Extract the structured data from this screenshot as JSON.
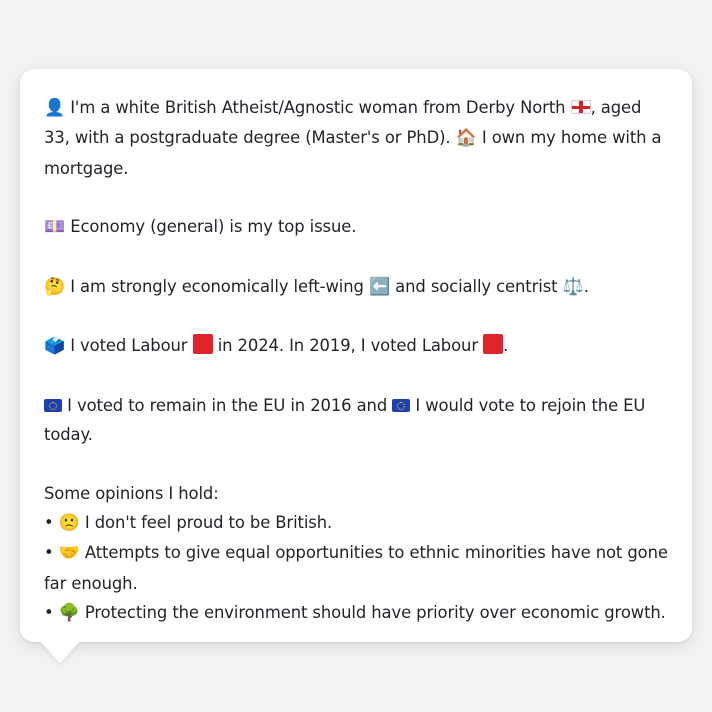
{
  "profile": {
    "p1": {
      "icon_person": "👤",
      "text_a": "I'm a white British Atheist/Agnostic woman from Derby North",
      "flag_england": "england-flag",
      "text_b": ", aged 33, with a postgraduate degree (Master's or PhD).",
      "icon_house": "🏠",
      "text_c": "I own my home with a mortgage."
    },
    "p2": {
      "icon_issue": "💷",
      "text": "Economy (general) is my top issue."
    },
    "p3": {
      "icon_think": "🤔",
      "text_a": "I am strongly economically left-wing",
      "icon_left": "⬅️",
      "text_b": "and socially centrist",
      "icon_scales": "⚖️",
      "text_c": "."
    },
    "p4": {
      "icon_ballot": "🗳️",
      "text_a": "I voted Labour",
      "party_color": "#e0252c",
      "text_b": "in 2024. In 2019, I voted Labour",
      "text_c": "."
    },
    "p5": {
      "flag_eu": "eu-flag",
      "text_a": "I voted to remain in the EU in 2016 and",
      "text_b": "I would vote to rejoin the EU today."
    },
    "opinions": {
      "heading": "Some opinions I hold:",
      "bullet": "•",
      "items": [
        {
          "icon": "🙁",
          "text": "I don't feel proud to be British."
        },
        {
          "icon": "🤝",
          "text": "Attempts to give equal opportunities to ethnic minorities have not gone far enough."
        },
        {
          "icon": "🌳",
          "text": "Protecting the environment should have priority over economic growth."
        }
      ]
    }
  }
}
